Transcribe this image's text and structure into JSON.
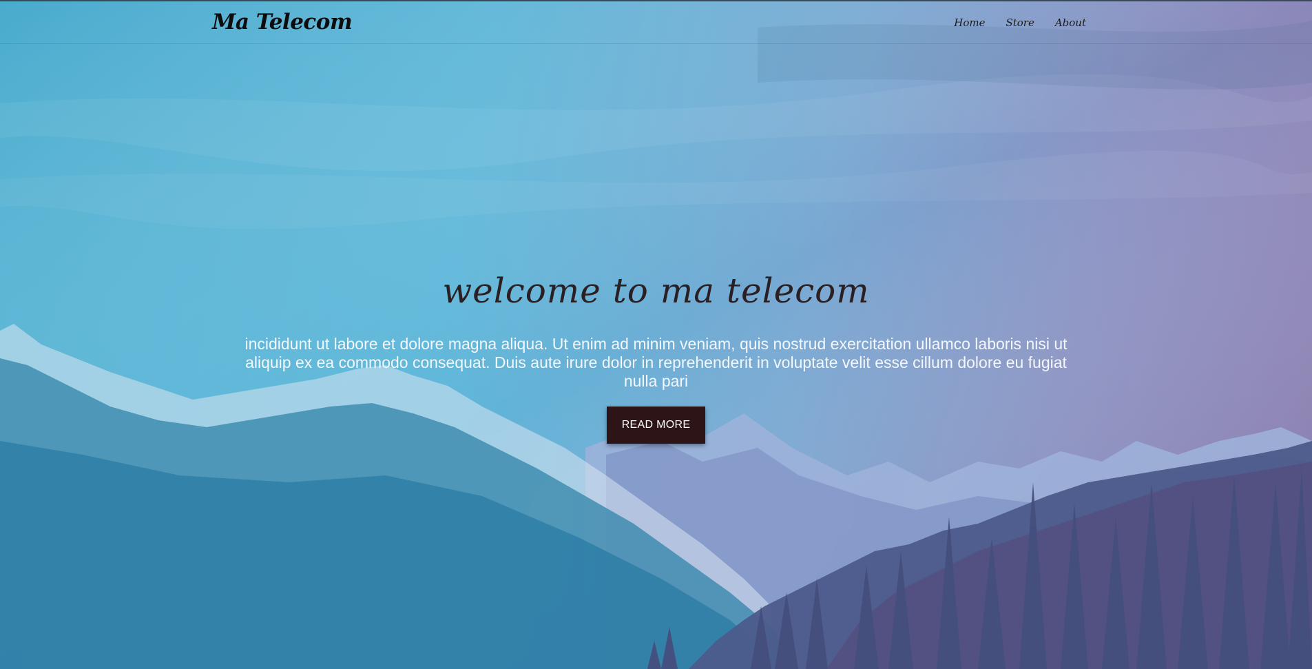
{
  "brand": "Ma Telecom",
  "nav": {
    "items": [
      {
        "label": "Home"
      },
      {
        "label": "Store"
      },
      {
        "label": "About"
      }
    ]
  },
  "hero": {
    "title": "welcome to ma telecom",
    "text": "incididunt ut labore et dolore magna aliqua. Ut enim ad minim veniam, quis nostrud exercitation ullamco laboris nisi ut aliquip ex ea commodo consequat. Duis aute irure dolor in reprehenderit in voluptate velit esse cillum dolore eu fugiat nulla pari",
    "button_label": "READ MORE"
  },
  "colors": {
    "button_bg": "#2d1416",
    "title_color": "#2a1f22",
    "sky_left": "#4fb1d2",
    "sky_right": "#8c7fb2"
  }
}
